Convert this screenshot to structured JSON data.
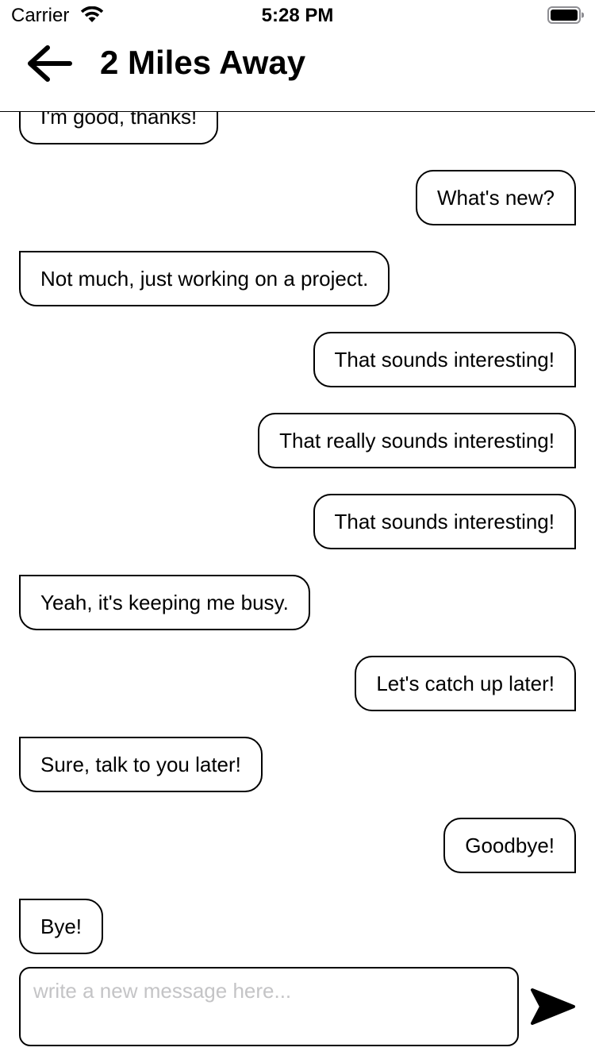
{
  "status_bar": {
    "carrier": "Carrier",
    "time": "5:28 PM",
    "wifi_icon": "wifi-icon",
    "battery_icon": "battery-full-icon"
  },
  "header": {
    "back_icon": "arrow-left-icon",
    "title": "2 Miles Away"
  },
  "messages": [
    {
      "from": "them",
      "text": "I'm good, thanks!"
    },
    {
      "from": "me",
      "text": "What's new?"
    },
    {
      "from": "them",
      "text": "Not much, just working on a project."
    },
    {
      "from": "me",
      "text": "That sounds interesting!"
    },
    {
      "from": "me",
      "text": "That really sounds interesting!"
    },
    {
      "from": "me",
      "text": "That sounds interesting!"
    },
    {
      "from": "them",
      "text": "Yeah, it's keeping me busy."
    },
    {
      "from": "me",
      "text": "Let's catch up later!"
    },
    {
      "from": "them",
      "text": "Sure, talk to you later!"
    },
    {
      "from": "me",
      "text": "Goodbye!"
    },
    {
      "from": "them",
      "text": "Bye!"
    }
  ],
  "composer": {
    "value": "",
    "placeholder": "write a new message here...",
    "send_icon": "send-icon"
  },
  "colors": {
    "text": "#000000",
    "background": "#ffffff",
    "placeholder": "#c4c4c6"
  }
}
